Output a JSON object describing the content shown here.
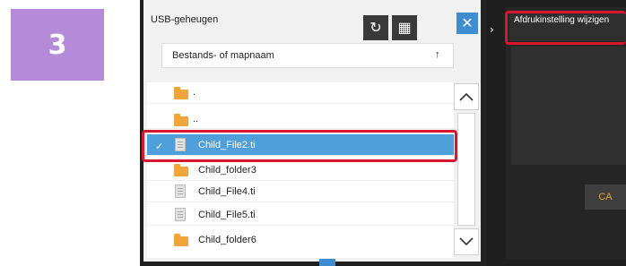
{
  "step": {
    "number": "3"
  },
  "panel": {
    "title": "USB-geheugen",
    "sort_label": "Bestands- of mapnaam",
    "sort_arrow": "↑"
  },
  "toolbar": {
    "refresh_icon": "↻",
    "grid_icon": "▦",
    "close_icon": "✕"
  },
  "list": {
    "items": [
      {
        "type": "folder",
        "label": "."
      },
      {
        "type": "folder",
        "label": ".."
      },
      {
        "type": "file",
        "label": "Child_File2.ti",
        "selected": true
      },
      {
        "type": "folder",
        "label": "Child_folder3"
      },
      {
        "type": "file",
        "label": "Child_File4.ti"
      },
      {
        "type": "file",
        "label": "Child_File5.ti"
      },
      {
        "type": "folder",
        "label": "Child_folder6"
      }
    ],
    "check_mark": "✓"
  },
  "side": {
    "chevron": "›",
    "button_label": "Afdrukinstelling wijzigen",
    "ca_label": "CA"
  },
  "colors": {
    "accent_blue": "#3e8dd3",
    "selection": "#4f9fdb",
    "highlight_red": "#d8172f",
    "step_purple": "#b48ad9",
    "folder": "#f0a43a"
  }
}
